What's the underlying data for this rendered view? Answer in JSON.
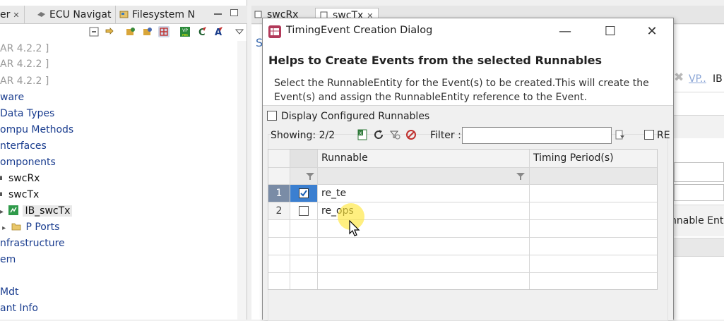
{
  "left_pane": {
    "tabs": [
      {
        "label": "er",
        "closable": true
      },
      {
        "label": "ECU Navigat",
        "icon": "ecu-navigator-icon"
      },
      {
        "label": "Filesystem N",
        "icon": "filesystem-icon"
      }
    ],
    "tree": [
      {
        "label": "AR 4.2.2 ]",
        "style": "gray"
      },
      {
        "label": "AR 4.2.2 ]",
        "style": "gray"
      },
      {
        "label": "AR 4.2.2 ]",
        "style": "gray"
      },
      {
        "label": "ware",
        "style": "blue"
      },
      {
        "label": "Data Types",
        "style": "blue"
      },
      {
        "label": "ompu Methods",
        "style": "blue"
      },
      {
        "label": "nterfaces",
        "style": "blue"
      },
      {
        "label": "omponents",
        "style": "blue"
      },
      {
        "label": "swcRx",
        "style": "dark"
      },
      {
        "label": "swcTx",
        "style": "dark"
      },
      {
        "label": "IB_swcTx",
        "style": "dark"
      },
      {
        "label": "P Ports",
        "style": "blue"
      },
      {
        "label": "nfrastructure",
        "style": "blue"
      },
      {
        "label": "em",
        "style": "blue"
      },
      {
        "label": "",
        "style": "blue"
      },
      {
        "label": "Mdt",
        "style": "blue"
      },
      {
        "label": "ant Info",
        "style": "blue"
      }
    ]
  },
  "editor": {
    "tabs": [
      {
        "label": "swcRx"
      },
      {
        "label": "swcTx",
        "closable": true
      }
    ],
    "background_letter": "S",
    "vp_link": "VP..",
    "ib_label": "IB",
    "runnable_entity_label": "nnable Enti"
  },
  "dialog": {
    "title": "TimingEvent Creation Dialog",
    "heading": "Helps to Create Events from the selected Runnables",
    "description": "Select the RunnableEntity for the Event(s) to be created.This will create the Event(s) and assign the RunnableEntity reference to the Event.",
    "display_configured_label": "Display Configured Runnables",
    "display_configured_checked": false,
    "showing_label": "Showing: 2/2",
    "filter_label": "Filter :",
    "filter_value": "",
    "re_label": "RE",
    "re_checked": false,
    "columns": [
      "Runnable",
      "Timing Period(s)"
    ],
    "rows": [
      {
        "num": "1",
        "checked": true,
        "runnable": "re_te",
        "timing": ""
      },
      {
        "num": "2",
        "checked": false,
        "runnable": "re_ops",
        "timing": ""
      }
    ],
    "colors": {
      "title_icon": "#b23a5a",
      "selection": "#3b7fd0",
      "heading": "#222222"
    }
  }
}
